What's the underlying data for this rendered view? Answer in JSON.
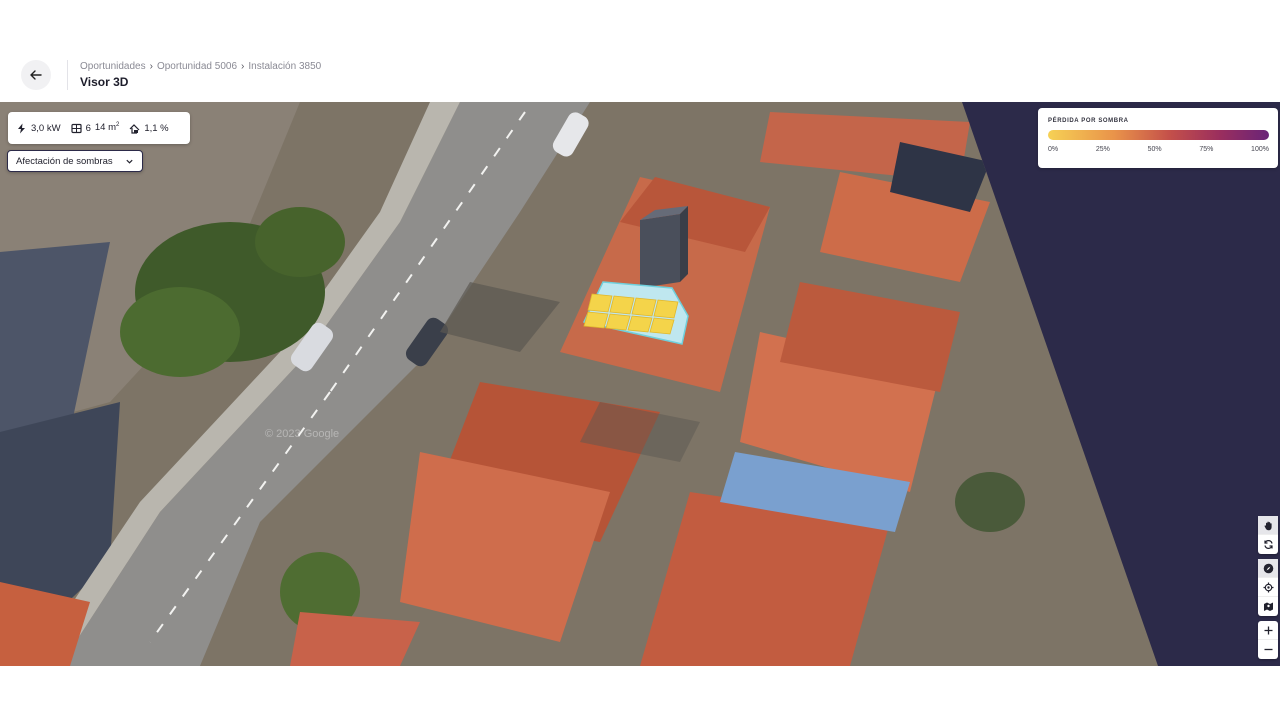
{
  "header": {
    "breadcrumb": [
      "Oportunidades",
      "Oportunidad 5006",
      "Instalación 3850"
    ],
    "title": "Visor 3D"
  },
  "stats": {
    "power": "3,0 kW",
    "panels": "6",
    "area": "14 m",
    "area_sup": "2",
    "loss": "1,1 %"
  },
  "layer_select": {
    "value": "Afectación de sombras"
  },
  "legend": {
    "title": "PÉRDIDA POR SOMBRA",
    "ticks": [
      "0%",
      "25%",
      "50%",
      "75%",
      "100%"
    ],
    "colors": [
      "#f6d155",
      "#e9934a",
      "#c4504a",
      "#9a2e5e",
      "#6a2478"
    ]
  },
  "map": {
    "watermark": "© 2023 Google"
  },
  "toolbar": {
    "icons": [
      "hand-icon",
      "rotate-icon",
      "compass-icon",
      "target-icon",
      "map-icon",
      "plus-icon",
      "minus-icon"
    ]
  }
}
